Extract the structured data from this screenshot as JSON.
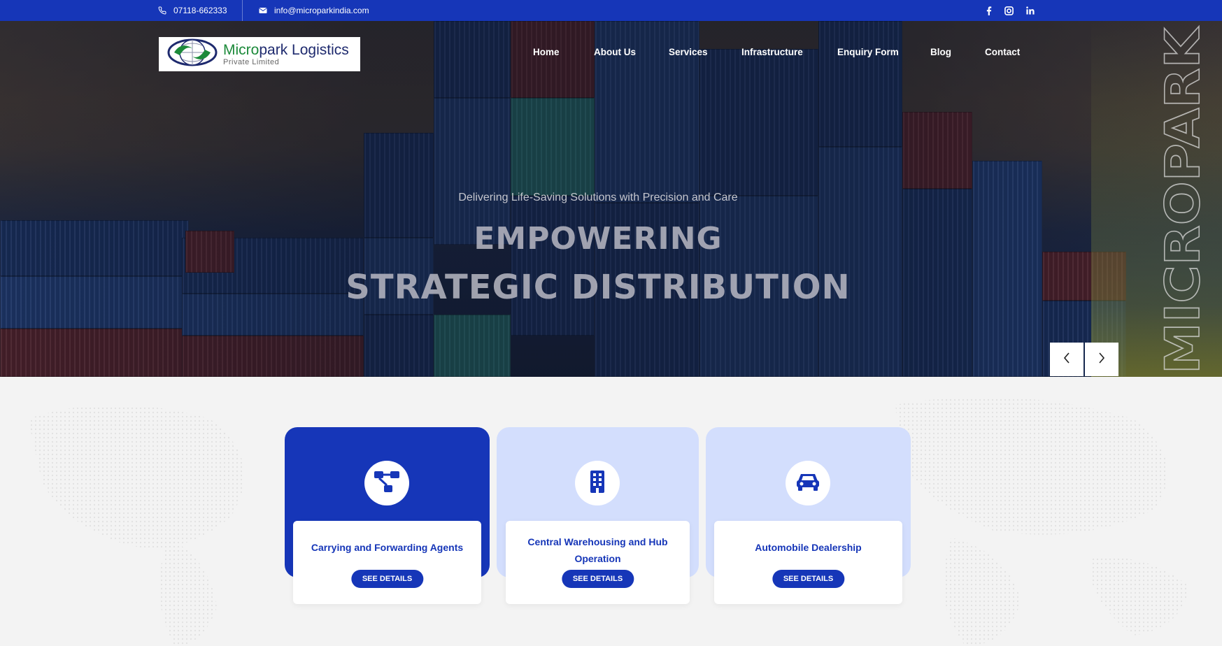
{
  "topbar": {
    "phone": "07118-662333",
    "email": "info@microparkindia.com",
    "social": [
      "facebook-icon",
      "instagram-icon",
      "linkedin-icon"
    ]
  },
  "logo": {
    "name_part1": "Micro",
    "name_part2": "park Logistics",
    "subtitle": "Private Limited"
  },
  "nav": {
    "items": [
      "Home",
      "About Us",
      "Services",
      "Infrastructure",
      "Enquiry Form",
      "Blog",
      "Contact"
    ]
  },
  "hero": {
    "tagline": "Delivering Life-Saving Solutions with Precision and Care",
    "headline_line1": "EMPOWERING",
    "headline_line2": "STRATEGIC DISTRIBUTION",
    "vertical_text": "MICROPARK"
  },
  "cards": [
    {
      "title": "Carrying and Forwarding Agents",
      "button": "SEE DETAILS",
      "icon": "network-icon"
    },
    {
      "title": "Central Warehousing and Hub Operation",
      "button": "SEE DETAILS",
      "icon": "building-icon"
    },
    {
      "title": "Automobile Dealership",
      "button": "SEE DETAILS",
      "icon": "car-icon"
    }
  ],
  "colors": {
    "primary": "#1636b8",
    "card_soft": "#d3defd"
  }
}
